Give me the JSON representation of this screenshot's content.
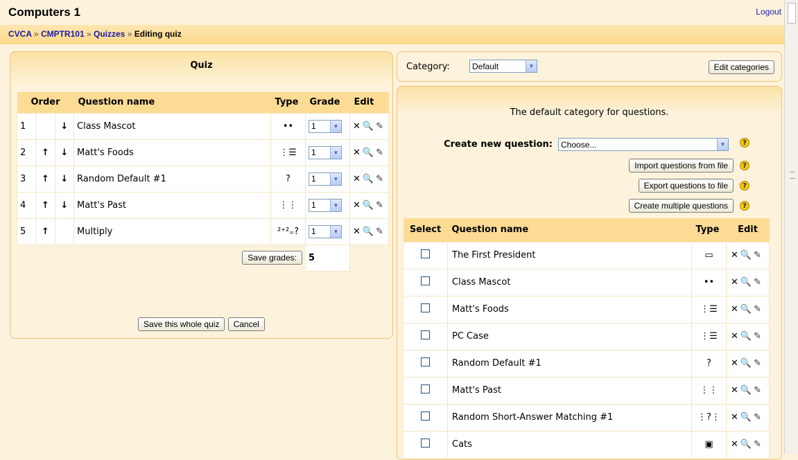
{
  "header": {
    "title": "Computers 1",
    "logout": "Logout",
    "breadcrumb": [
      "CVCA",
      "CMPTR101",
      "Quizzes",
      "Editing quiz"
    ],
    "separator": "»"
  },
  "quiz": {
    "title": "Quiz",
    "columns": [
      "Order",
      "Question name",
      "Type",
      "Grade",
      "Edit"
    ],
    "rows": [
      {
        "num": "1",
        "up": "",
        "down": "↓",
        "name": "Class Mascot",
        "type": "••",
        "grade": "1"
      },
      {
        "num": "2",
        "up": "↑",
        "down": "↓",
        "name": "Matt's Foods",
        "type": "⋮☰",
        "grade": "1"
      },
      {
        "num": "3",
        "up": "↑",
        "down": "↓",
        "name": "Random Default #1",
        "type": "?",
        "grade": "1"
      },
      {
        "num": "4",
        "up": "↑",
        "down": "↓",
        "name": "Matt's Past",
        "type": "⋮⋮",
        "grade": "1"
      },
      {
        "num": "5",
        "up": "↑",
        "down": "",
        "name": "Multiply",
        "type": "²⁺²₌?",
        "grade": "1"
      }
    ],
    "save_grades_label": "Save grades:",
    "total": "5",
    "save_whole_label": "Save this whole quiz",
    "cancel_label": "Cancel"
  },
  "category": {
    "label": "Category:",
    "selected": "Default",
    "edit_label": "Edit categories"
  },
  "bank": {
    "description": "The default category for questions.",
    "create_label": "Create new question:",
    "create_selected": "Choose...",
    "import_label": "Import questions from file",
    "export_label": "Export questions to file",
    "multiple_label": "Create multiple questions",
    "columns": [
      "Select",
      "Question name",
      "Type",
      "Edit"
    ],
    "rows": [
      {
        "name": "The First President",
        "type": "▭"
      },
      {
        "name": "Class Mascot",
        "type": "••"
      },
      {
        "name": "Matt's Foods",
        "type": "⋮☰"
      },
      {
        "name": "PC Case",
        "type": "⋮☰"
      },
      {
        "name": "Random Default #1",
        "type": "?"
      },
      {
        "name": "Matt's Past",
        "type": "⋮⋮"
      },
      {
        "name": "Random Short-Answer Matching #1",
        "type": "⋮?⋮"
      },
      {
        "name": "Cats",
        "type": "▣"
      }
    ]
  },
  "icons": {
    "delete": "✕",
    "preview": "🔍",
    "edit": "✎",
    "help": "?",
    "dropdown": "▼"
  }
}
